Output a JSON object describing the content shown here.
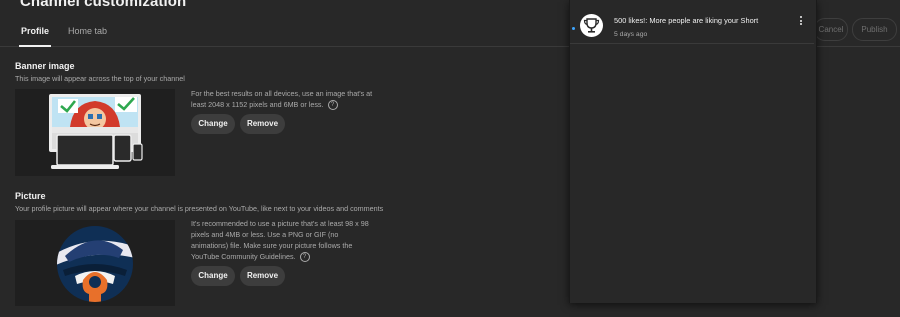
{
  "header": {
    "title": "Channel customization"
  },
  "tabs": [
    {
      "label": "Profile",
      "active": true
    },
    {
      "label": "Home tab",
      "active": false
    }
  ],
  "actions": {
    "cancel": "Cancel",
    "publish": "Publish"
  },
  "banner": {
    "title": "Banner image",
    "description": "This image will appear across the top of your channel",
    "info_line1": "For the best results on all devices, use an image that's at",
    "info_line2": "least 2048 x 1152 pixels and 6MB or less.",
    "change": "Change",
    "remove": "Remove"
  },
  "picture": {
    "title": "Picture",
    "description": "Your profile picture will appear where your channel is presented on YouTube, like next to your videos and comments",
    "info_line1": "It's recommended to use a picture that's at least 98 x 98",
    "info_line2": "pixels and 4MB or less. Use a PNG or GIF (no",
    "info_line3": "animations) file. Make sure your picture follows the",
    "info_line4": "YouTube Community Guidelines.",
    "change": "Change",
    "remove": "Remove"
  },
  "notifications": [
    {
      "title": "500 likes!: More people are liking your Short",
      "time": "5 days ago",
      "icon": "trophy-icon",
      "unread": true
    }
  ],
  "colors": {
    "background": "#282828",
    "panel": "#282828",
    "accent": "#3ea6ff",
    "text": "#f1f1f1",
    "muted": "#aaaaaa",
    "orange": "#e8702a"
  }
}
